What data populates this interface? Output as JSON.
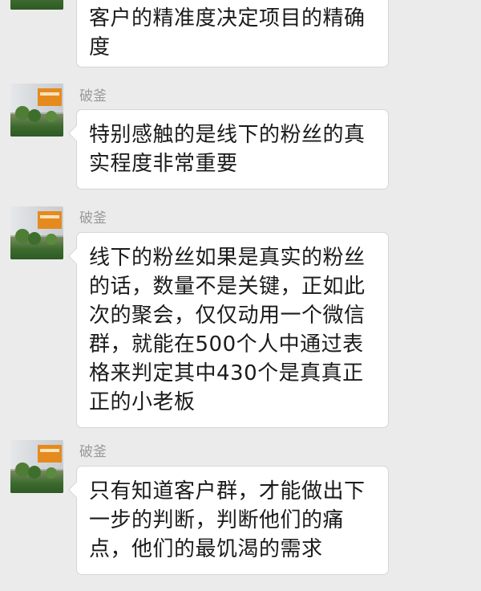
{
  "messages": [
    {
      "sender": "",
      "text": "客户的精准度决定项目的精确度"
    },
    {
      "sender": "破釜",
      "text": "特别感触的是线下的粉丝的真实程度非常重要"
    },
    {
      "sender": "破釜",
      "text": "线下的粉丝如果是真实的粉丝的话，数量不是关键，正如此次的聚会，仅仅动用一个微信群，就能在500个人中通过表格来判定其中430个是真真正正的小老板"
    },
    {
      "sender": "破釜",
      "text": "只有知道客户群，才能做出下一步的判断，判断他们的痛点，他们的最饥渴的需求"
    }
  ],
  "colors": {
    "background": "#ebebeb",
    "bubble": "#ffffff",
    "sender_name": "#9a9a9a",
    "text": "#1b1b1b"
  },
  "icons": {
    "avatar": "profile-photo-office-orange-sign"
  }
}
